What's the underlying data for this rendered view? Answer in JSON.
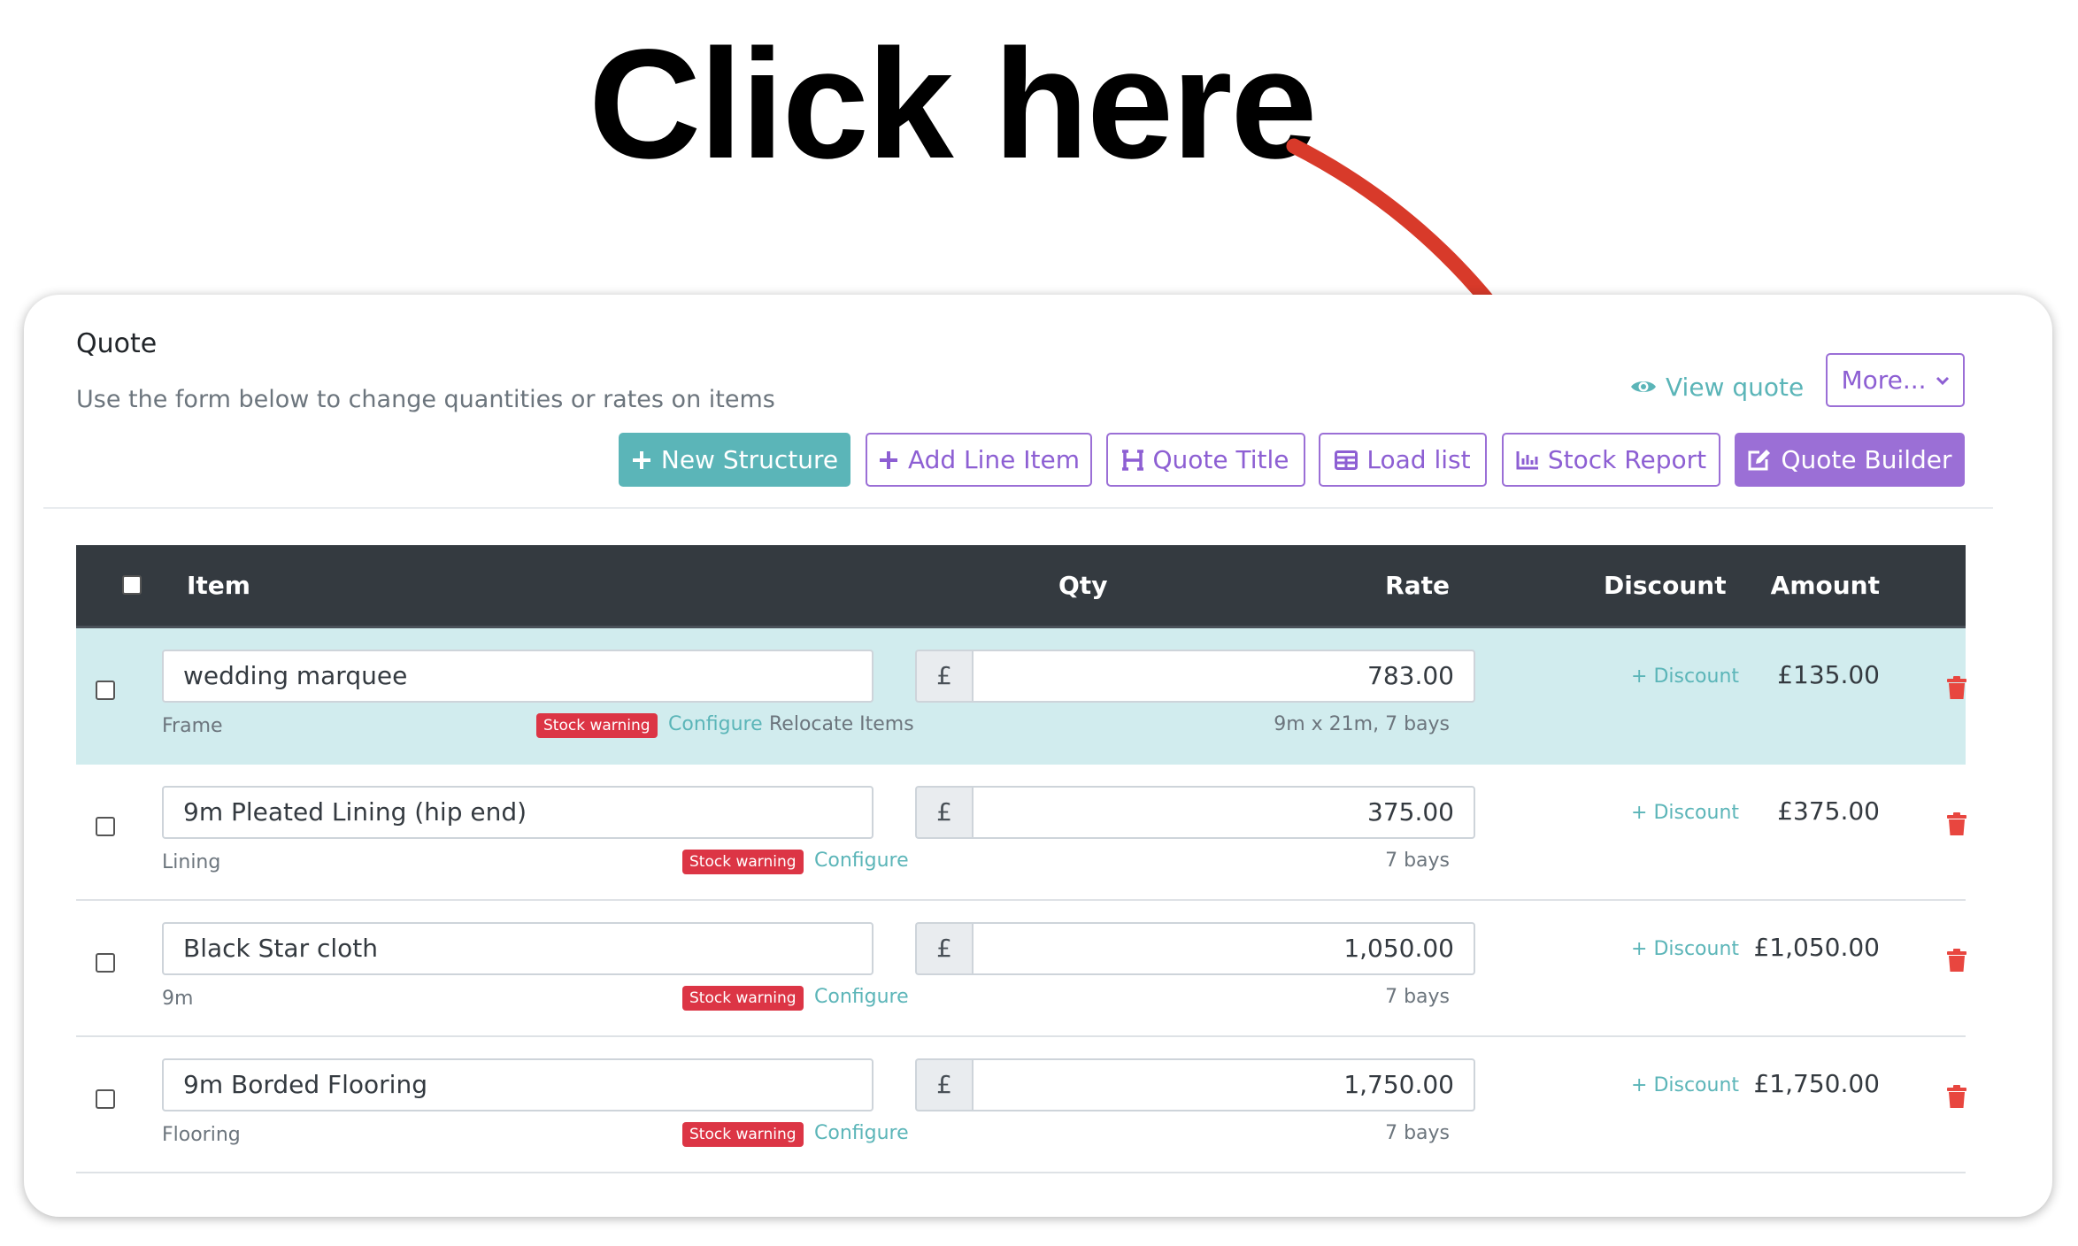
{
  "annotation": {
    "headline": "Click here"
  },
  "card": {
    "title": "Quote",
    "subtitle": "Use the form below to change quantities or rates on items"
  },
  "toolbar": {
    "view_quote": "View quote",
    "more": "More...",
    "new_structure": "New Structure",
    "add_line_item": "Add Line Item",
    "quote_title": "Quote Title",
    "load_list": "Load list",
    "stock_report": "Stock Report",
    "quote_builder": "Quote Builder"
  },
  "table": {
    "headers": {
      "item": "Item",
      "qty": "Qty",
      "rate": "Rate",
      "discount": "Discount",
      "amount": "Amount"
    },
    "rows": [
      {
        "name": "wedding marquee",
        "category": "Frame",
        "badge": "Stock warning",
        "configure": "Configure",
        "relocate": "Relocate Items",
        "currency": "£",
        "rate": "783.00",
        "rate_note": "9m x 21m, 7 bays",
        "discount": "Discount",
        "amount": "£135.00"
      },
      {
        "name": "9m Pleated Lining (hip end)",
        "category": "Lining",
        "badge": "Stock warning",
        "configure": "Configure",
        "currency": "£",
        "rate": "375.00",
        "rate_note": "7 bays",
        "discount": "Discount",
        "amount": "£375.00"
      },
      {
        "name": "Black Star cloth",
        "category": "9m",
        "badge": "Stock warning",
        "configure": "Configure",
        "currency": "£",
        "rate": "1,050.00",
        "rate_note": "7 bays",
        "discount": "Discount",
        "amount": "£1,050.00"
      },
      {
        "name": "9m Borded Flooring",
        "category": "Flooring",
        "badge": "Stock warning",
        "configure": "Configure",
        "currency": "£",
        "rate": "1,750.00",
        "rate_note": "7 bays",
        "discount": "Discount",
        "amount": "£1,750.00"
      }
    ]
  },
  "colors": {
    "teal": "#5bb5b8",
    "purple": "#9b6fd6",
    "header_dark": "#343a40",
    "danger": "#dc3545",
    "highlight_row": "#d1ecee",
    "arrow": "#d83a2a"
  }
}
